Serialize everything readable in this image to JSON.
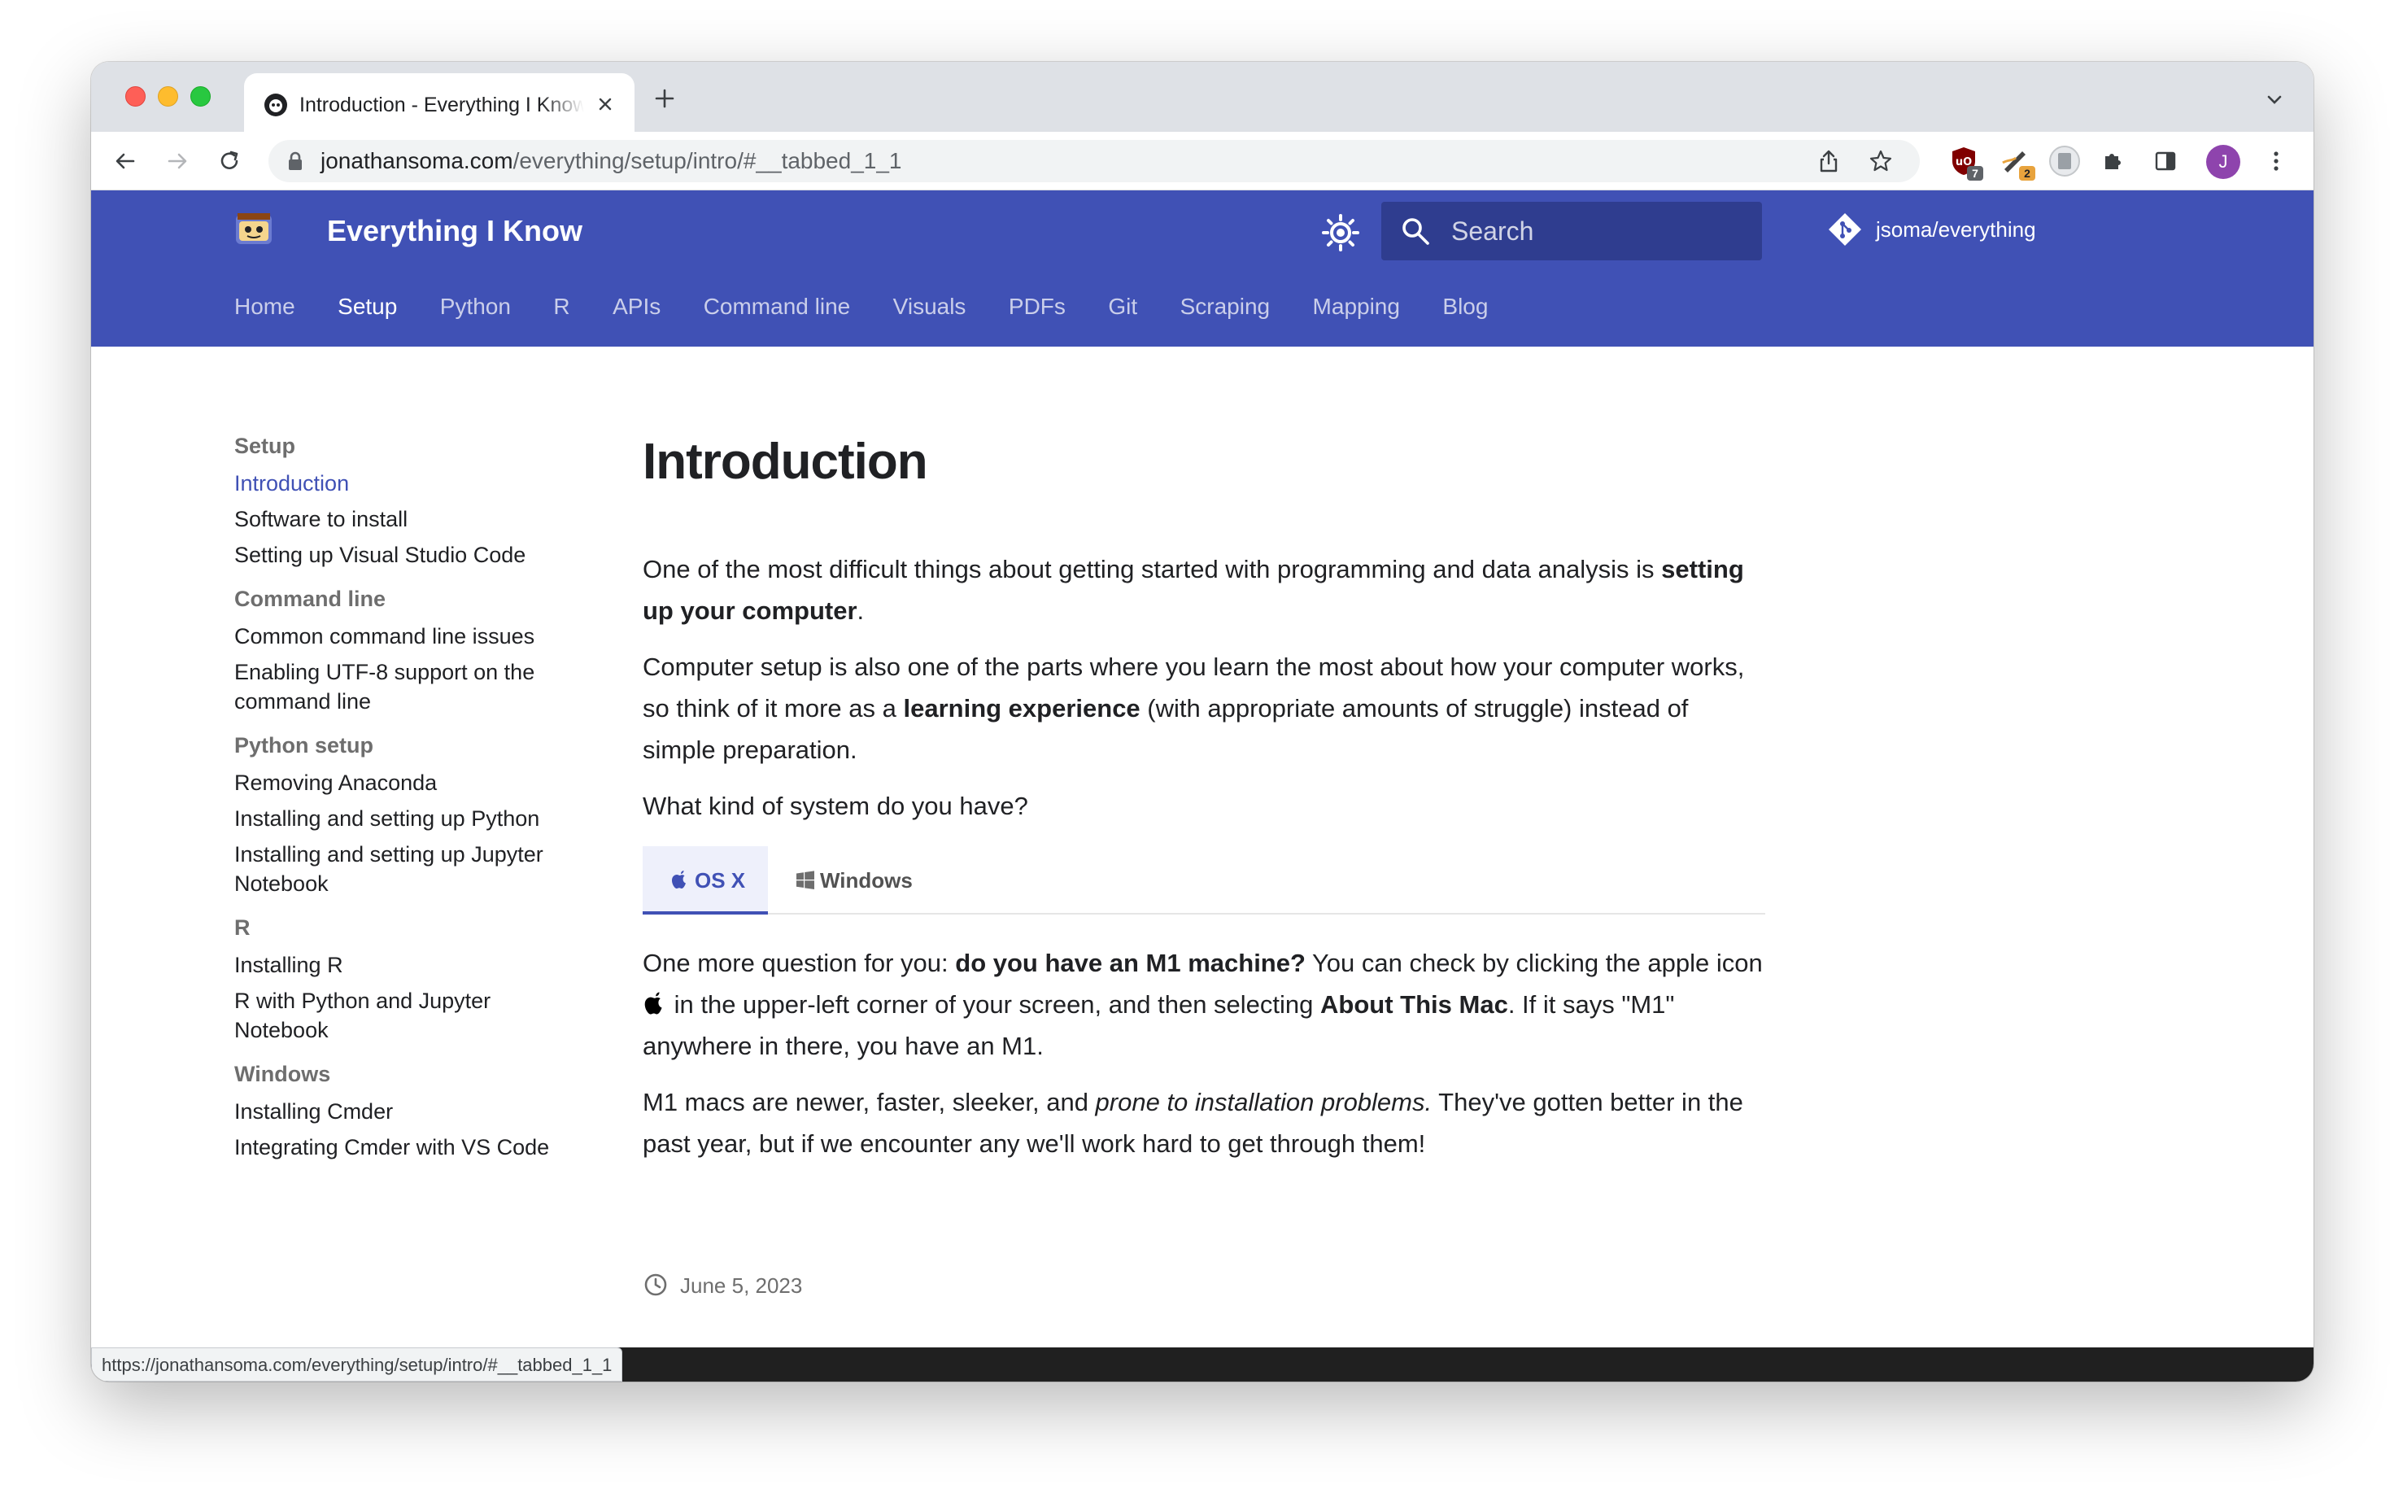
{
  "browser": {
    "tab_title": "Introduction - Everything I Know",
    "url_host": "jonathansoma.com",
    "url_path": "/everything/setup/intro/#__tabbed_1_1",
    "extensions": [
      {
        "icon": "ublock-icon",
        "badge": "7",
        "color": "#800000"
      },
      {
        "icon": "pen-extension-icon",
        "badge": "2",
        "color": "#e8a33d"
      },
      {
        "icon": "reader-extension-icon",
        "badge": "",
        "color": "#9aa0a6"
      }
    ],
    "profile_initial": "J",
    "status_url": "https://jonathansoma.com/everything/setup/intro/#__tabbed_1_1"
  },
  "site": {
    "title": "Everything I Know",
    "search_placeholder": "Search",
    "repo": "jsoma/everything",
    "nav": [
      "Home",
      "Setup",
      "Python",
      "R",
      "APIs",
      "Command line",
      "Visuals",
      "PDFs",
      "Git",
      "Scraping",
      "Mapping",
      "Blog"
    ],
    "nav_active": "Setup",
    "primary_color": "#4051b5"
  },
  "sidebar": {
    "sections": [
      {
        "title": "Setup",
        "items": [
          "Introduction",
          "Software to install",
          "Setting up Visual Studio Code"
        ]
      },
      {
        "title": "Command line",
        "items": [
          "Common command line issues",
          "Enabling UTF-8 support on the command line"
        ]
      },
      {
        "title": "Python setup",
        "items": [
          "Removing Anaconda",
          "Installing and setting up Python",
          "Installing and setting up Jupyter Notebook"
        ]
      },
      {
        "title": "R",
        "items": [
          "Installing R",
          "R with Python and Jupyter Notebook"
        ]
      },
      {
        "title": "Windows",
        "items": [
          "Installing Cmder",
          "Integrating Cmder with VS Code"
        ]
      }
    ],
    "active_item": "Introduction"
  },
  "content": {
    "title": "Introduction",
    "p1_a": "One of the most difficult things about getting started with programming and data analysis is ",
    "p1_b": "setting up your computer",
    "p1_c": ".",
    "p2_a": "Computer setup is also one of the parts where you learn the most about how your computer works, so think of it more as a ",
    "p2_b": "learning experience",
    "p2_c": " (with appropriate amounts of struggle) instead of simple preparation.",
    "p3": "What kind of system do you have?",
    "tabs": [
      "OS X",
      "Windows"
    ],
    "tab_active": "OS X",
    "p4_a": "One more question for you: ",
    "p4_b": "do you have an M1 machine?",
    "p4_c": " You can check by clicking the apple icon ",
    "p4_d": " in the upper-left corner of your screen, and then selecting ",
    "p4_e": "About This Mac",
    "p4_f": ". If it says \"M1\" anywhere in there, you have an M1.",
    "p5_a": "M1 macs are newer, faster, sleeker, and ",
    "p5_b": "prone to installation problems.",
    "p5_c": " They've gotten better in the past year, but if we encounter any we'll work hard to get through them!",
    "updated": "June 5, 2023"
  }
}
